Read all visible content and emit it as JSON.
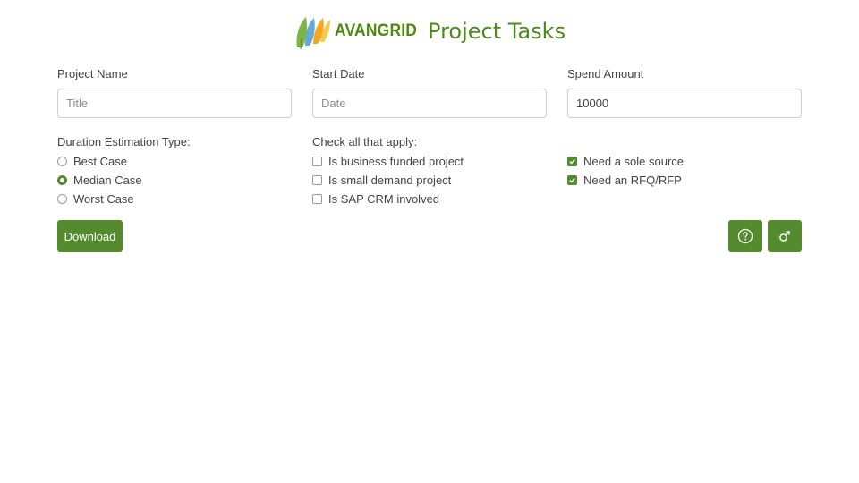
{
  "header": {
    "brand": "AVANGRID",
    "title": "Project Tasks"
  },
  "form": {
    "project_name": {
      "label": "Project Name",
      "placeholder": "Title",
      "value": ""
    },
    "start_date": {
      "label": "Start Date",
      "placeholder": "Date",
      "value": ""
    },
    "spend_amount": {
      "label": "Spend Amount",
      "placeholder": "",
      "value": "10000"
    }
  },
  "duration": {
    "label": "Duration Estimation Type:",
    "options": [
      {
        "label": "Best Case",
        "selected": false
      },
      {
        "label": "Median Case",
        "selected": true
      },
      {
        "label": "Worst Case",
        "selected": false
      }
    ]
  },
  "checks": {
    "label": "Check all that apply:",
    "left": [
      {
        "label": "Is business funded project",
        "checked": false
      },
      {
        "label": "Is small demand project",
        "checked": false
      },
      {
        "label": "Is SAP CRM involved",
        "checked": false
      }
    ],
    "right": [
      {
        "label": "Need a sole source",
        "checked": true
      },
      {
        "label": "Need an RFQ/RFP",
        "checked": true
      }
    ]
  },
  "actions": {
    "download_label": "Download",
    "help_icon": "question-circle-icon",
    "settings_icon": "gender-icon"
  },
  "colors": {
    "accent": "#558b2f",
    "brand_green": "#4e8a1e"
  }
}
